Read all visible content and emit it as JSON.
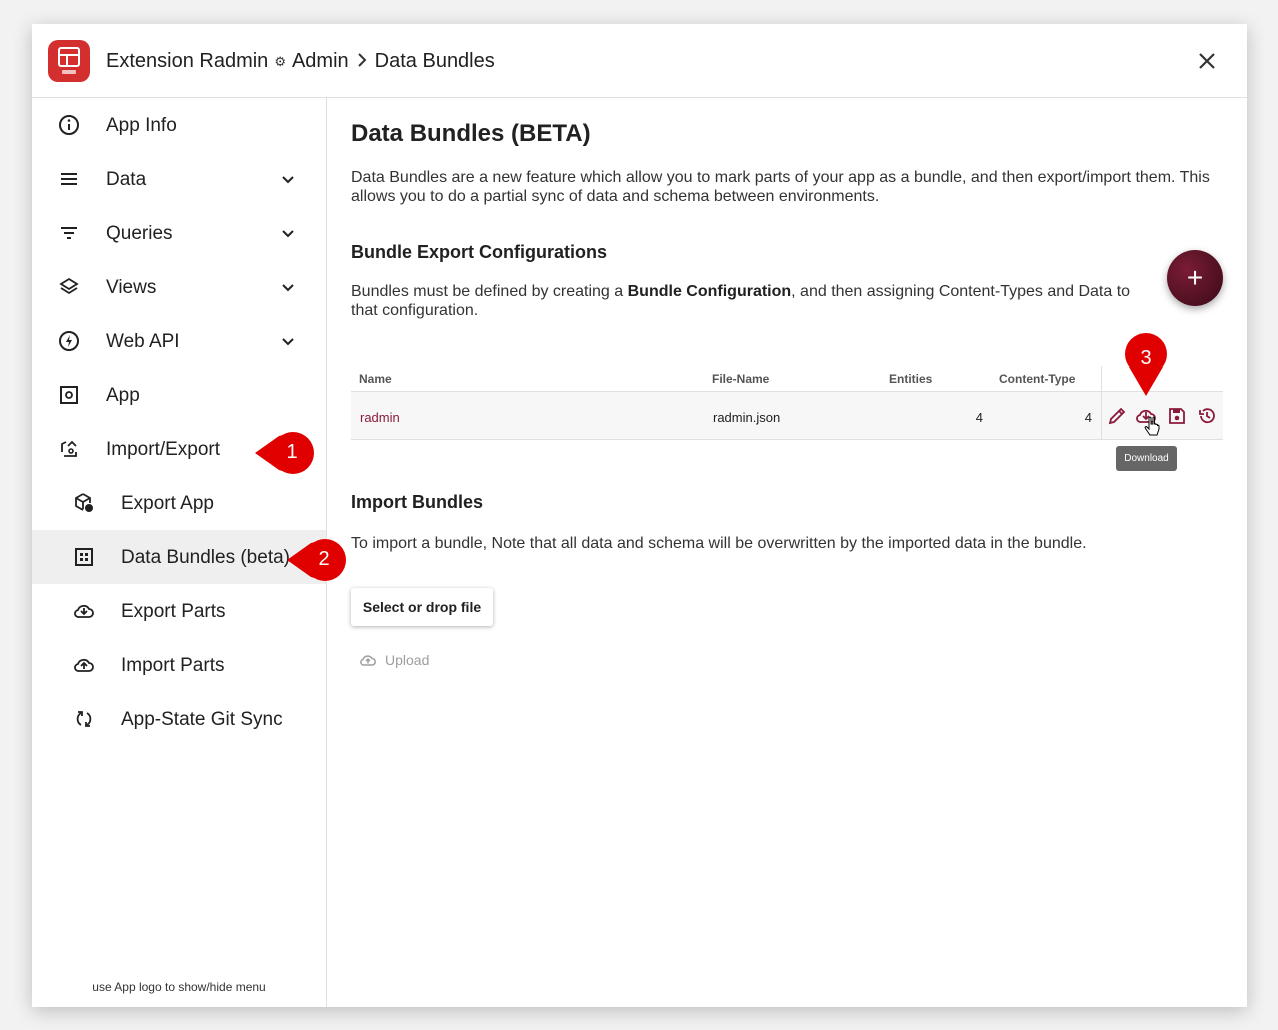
{
  "header": {
    "app_name": "Extension Radmin",
    "section": "Admin",
    "page": "Data Bundles"
  },
  "sidebar": {
    "items": [
      {
        "label": "App Info",
        "icon": "info-icon"
      },
      {
        "label": "Data",
        "icon": "menu-lines-icon"
      },
      {
        "label": "Queries",
        "icon": "filter-icon"
      },
      {
        "label": "Views",
        "icon": "layers-icon"
      },
      {
        "label": "Web API",
        "icon": "bolt-icon"
      },
      {
        "label": "App",
        "icon": "app-settings-icon"
      },
      {
        "label": "Import/Export",
        "icon": "import-export-icon"
      }
    ],
    "sub_items": [
      {
        "label": "Export App",
        "icon": "package-icon"
      },
      {
        "label": "Data Bundles (beta)",
        "icon": "grid-icon"
      },
      {
        "label": "Export Parts",
        "icon": "cloud-download-icon"
      },
      {
        "label": "Import Parts",
        "icon": "cloud-upload-icon"
      },
      {
        "label": "App-State Git Sync",
        "icon": "sync-icon"
      }
    ],
    "hint": "use App logo to show/hide menu"
  },
  "main": {
    "title": "Data Bundles (BETA)",
    "intro": "Data Bundles are a new feature which allow you to mark parts of your app as a bundle, and then export/import them. This allows you to do a partial sync of data and schema between environments.",
    "export_title": "Bundle Export Configurations",
    "export_text_before": "Bundles must be defined by creating a ",
    "export_text_bold": "Bundle Configuration",
    "export_text_after": ", and then assigning Content-Types and Data to that configuration.",
    "fab_label": "+",
    "table": {
      "columns": [
        "Name",
        "File-Name",
        "Entities",
        "Content-Type"
      ],
      "rows": [
        {
          "name": "radmin",
          "file_name": "radmin.json",
          "entities": "4",
          "content_type": "4"
        }
      ]
    },
    "tooltip": "Download",
    "import_title": "Import Bundles",
    "import_text": "To import a bundle, Note that all data and schema will be overwritten by the imported data in the bundle.",
    "select_button": "Select or drop file",
    "upload_button": "Upload"
  },
  "markers": [
    "1",
    "2",
    "3"
  ],
  "colors": {
    "accent": "#8b1a3a",
    "logo": "#d32f2f",
    "marker": "#e00000"
  }
}
